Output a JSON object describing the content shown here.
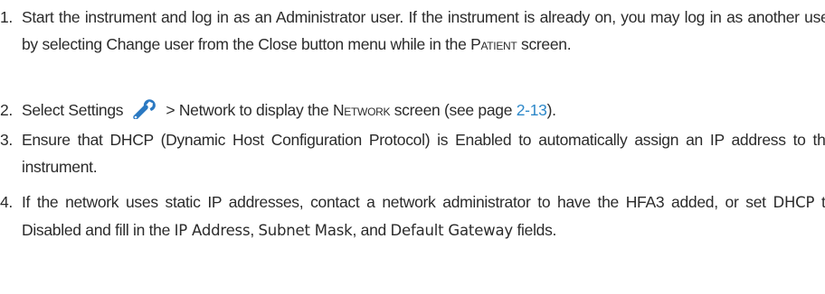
{
  "steps": [
    {
      "number": "1.",
      "text_a": "Start the instrument and log in as an Administrator user. If the instrument is already on, you may log in as another user by selecting Change user from the Close button menu while in the ",
      "screen_name": "Patient",
      "text_b": " screen."
    },
    {
      "number": "2.",
      "text_a": "Select Settings",
      "icon": "wrench-icon",
      "text_b": " > Network to display the ",
      "screen_name": "Network",
      "text_c": " screen (see page ",
      "page_ref": "2-13",
      "text_d": ")."
    },
    {
      "number": "3.",
      "text": "Ensure that DHCP (Dynamic Host Configuration Protocol) is Enabled to automatically assign an IP address to the instrument."
    },
    {
      "number": "4.",
      "text_a": "If the network uses static IP addresses, contact a network administrator to have the HFA3 added, or set ",
      "term_dhcp": "DHCP",
      "text_b": " to Disabled and fill in the ",
      "term_ip": "IP Address",
      "sep_1": ", ",
      "term_subnet": "Subnet Mask",
      "sep_2": ", and ",
      "term_gateway": "Default Gateway",
      "text_c": " fields."
    }
  ],
  "colors": {
    "text": "#2b2b2b",
    "link": "#2d88c9",
    "icon": "#2b79c2"
  }
}
